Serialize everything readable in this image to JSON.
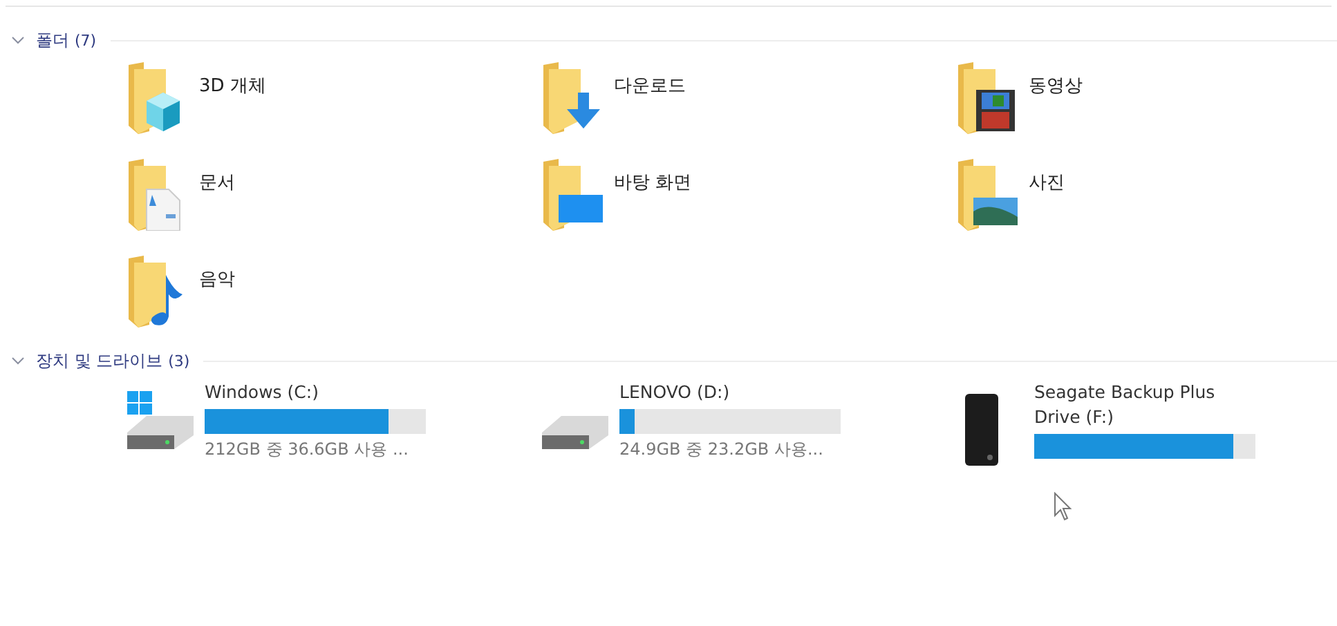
{
  "sections": [
    {
      "title": "폴더",
      "count": "(7)",
      "expanded": true,
      "kind": "folders",
      "items": [
        {
          "name": "3D 개체",
          "kind": "cube"
        },
        {
          "name": "다운로드",
          "kind": "download"
        },
        {
          "name": "동영상",
          "kind": "video"
        },
        {
          "name": "문서",
          "kind": "document"
        },
        {
          "name": "바탕 화면",
          "kind": "desktop"
        },
        {
          "name": "사진",
          "kind": "photo"
        },
        {
          "name": "음악",
          "kind": "music"
        }
      ]
    },
    {
      "title": "장치 및 드라이브",
      "count": "(3)",
      "expanded": true,
      "kind": "drives",
      "items": [
        {
          "name": "Windows (C:)",
          "kind": "system",
          "level": 0.83,
          "usage": "212GB 중 36.6GB 사용 ..."
        },
        {
          "name": "LENOVO (D:)",
          "kind": "hdd",
          "level": 0.07,
          "usage": "24.9GB 중 23.2GB 사용..."
        },
        {
          "name": "Seagate Backup Plus Drive (F:)",
          "kind": "external",
          "level": 0.9
        }
      ]
    }
  ]
}
